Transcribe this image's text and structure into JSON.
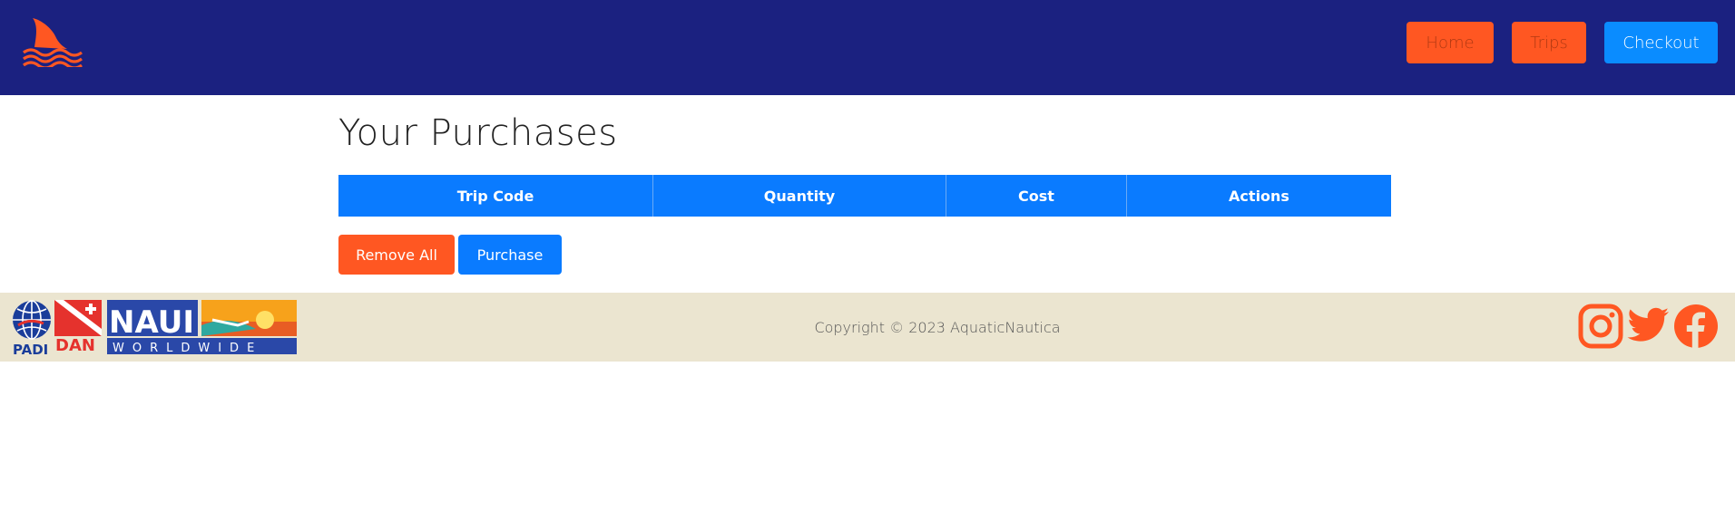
{
  "brand": {
    "logo_icon": "shark-fin-icon",
    "accent_color": "#ff5722",
    "nav_color": "#1b2180",
    "primary_color": "#0a7bff"
  },
  "nav": {
    "items": [
      {
        "label": "Home"
      },
      {
        "label": "Trips"
      },
      {
        "label": "Checkout"
      }
    ]
  },
  "main": {
    "title": "Your Purchases",
    "table": {
      "columns": [
        "Trip Code",
        "Quantity",
        "Cost",
        "Actions"
      ],
      "rows": []
    },
    "remove_all_label": "Remove All",
    "purchase_label": "Purchase"
  },
  "footer": {
    "copyright": "Copyright © 2023 AquaticNautica",
    "partners": [
      "PADI",
      "DAN",
      "NAUI",
      "WORLDWIDE"
    ],
    "social_icons": [
      "instagram-icon",
      "twitter-icon",
      "facebook-icon"
    ]
  }
}
